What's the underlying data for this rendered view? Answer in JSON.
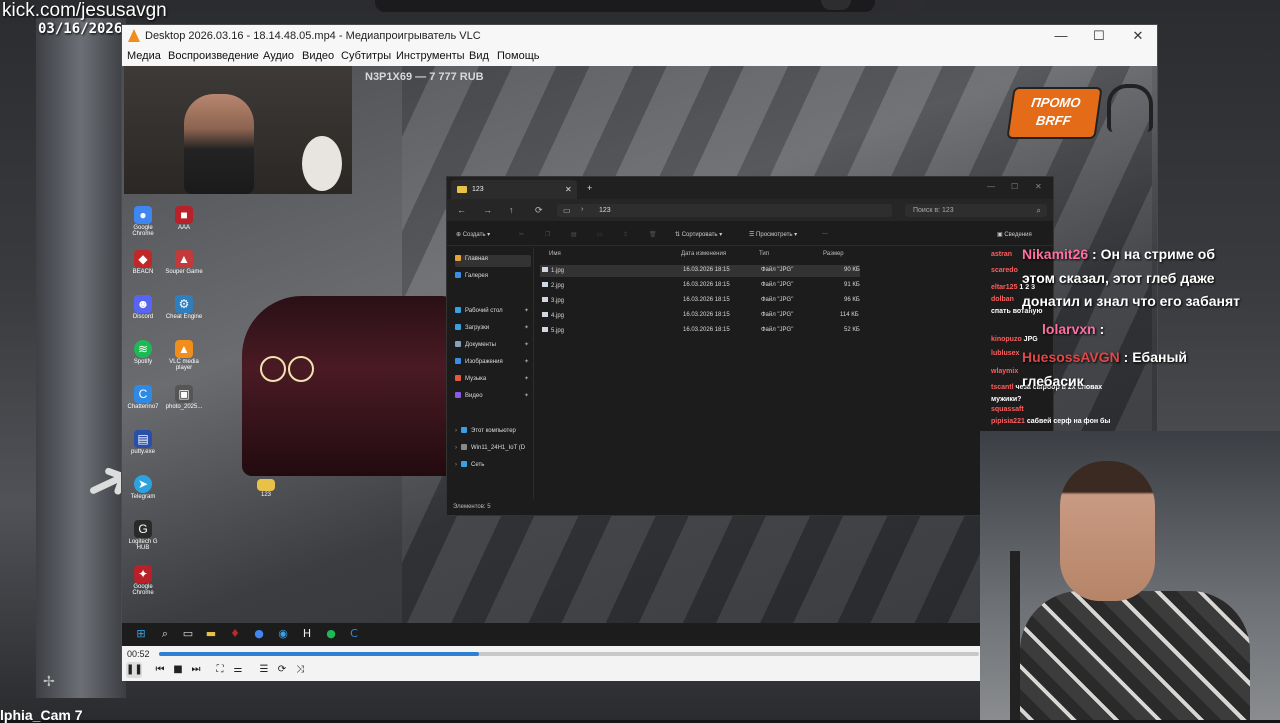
{
  "stream": {
    "url": "kick.com/jesusavgn",
    "date": "03/16/2026",
    "cam_label": "lphia_Cam 7",
    "overlay_price": "N3P1X69 — 7 777 RUB",
    "promo_line1": "ПРОМО",
    "promo_line2": "BRFF"
  },
  "vlc": {
    "title": "Desktop 2026.03.16 - 18.14.48.05.mp4 - Медиапроигрыватель VLC",
    "menu": [
      "Медиа",
      "Воспроизведение",
      "Аудио",
      "Видео",
      "Субтитры",
      "Инструменты",
      "Вид",
      "Помощь"
    ],
    "elapsed": "00:52",
    "progress_fraction": 0.39,
    "accent": "#2f7fd3"
  },
  "desktop_icons": [
    {
      "label": "Google Chrome",
      "icon": "chrome-icon",
      "color": "#3f86f0"
    },
    {
      "label": "ААА",
      "icon": "app-icon",
      "color": "#b8202a"
    },
    {
      "label": "BEACN",
      "icon": "beacn-icon",
      "color": "#c02828"
    },
    {
      "label": "Souper Game",
      "icon": "game-icon",
      "color": "#c43a3a"
    },
    {
      "label": "Discord",
      "icon": "discord-icon",
      "color": "#5865f2"
    },
    {
      "label": "Cheat Engine",
      "icon": "cheat-engine-icon",
      "color": "#2d7fbf"
    },
    {
      "label": "Spotify",
      "icon": "spotify-icon",
      "color": "#1db954"
    },
    {
      "label": "VLC media player",
      "icon": "vlc-icon",
      "color": "#f08d1b"
    },
    {
      "label": "Chatterino7",
      "icon": "chatterino-icon",
      "color": "#2f8ae6"
    },
    {
      "label": "photo_2025...",
      "icon": "photo-icon",
      "color": "#555555"
    },
    {
      "label": "putty.exe",
      "icon": "putty-icon",
      "color": "#2a4fa8"
    },
    {
      "label": "Telegram",
      "icon": "telegram-icon",
      "color": "#2aa3e0"
    },
    {
      "label": "123",
      "icon": "folder-icon",
      "color": "#e8c14a"
    },
    {
      "label": "Logitech G HUB",
      "icon": "logitech-icon",
      "color": "#2a2a2a"
    },
    {
      "label": "Google Chrome",
      "icon": "app-icon",
      "color": "#b8202a"
    }
  ],
  "explorer": {
    "tab_title": "123",
    "path": "123",
    "search_placeholder": "Поиск в: 123",
    "toolbar": {
      "create": "Создать",
      "sort": "Сортировать",
      "view": "Просмотреть",
      "more": "···",
      "details": "Сведения"
    },
    "sidebar": [
      {
        "label": "Главная",
        "icon": "home-icon",
        "color": "#e5a23a"
      },
      {
        "label": "Галерея",
        "icon": "gallery-icon",
        "color": "#3a8ee5"
      },
      {
        "label": "Рабочий стол",
        "icon": "desktop-icon",
        "color": "#3aa0e5"
      },
      {
        "label": "Загрузки",
        "icon": "downloads-icon",
        "color": "#3aa0e5"
      },
      {
        "label": "Документы",
        "icon": "documents-icon",
        "color": "#8aa0b8"
      },
      {
        "label": "Изображения",
        "icon": "pictures-icon",
        "color": "#3a8ee5"
      },
      {
        "label": "Музыка",
        "icon": "music-icon",
        "color": "#e55a3a"
      },
      {
        "label": "Видео",
        "icon": "videos-icon",
        "color": "#8a5ae5"
      },
      {
        "label": "Этот компьютер",
        "icon": "computer-icon",
        "color": "#3aa0e5"
      },
      {
        "label": "Win11_24H1_IoT (D",
        "icon": "drive-icon",
        "color": "#888888"
      },
      {
        "label": "Сеть",
        "icon": "network-icon",
        "color": "#3aa0e5"
      }
    ],
    "columns": [
      "Имя",
      "Дата изменения",
      "Тип",
      "Размер"
    ],
    "files": [
      {
        "name": "1.jpg",
        "date": "16.03.2026 18:15",
        "type": "Файл \"JPG\"",
        "size": "90 КБ"
      },
      {
        "name": "2.jpg",
        "date": "16.03.2026 18:15",
        "type": "Файл \"JPG\"",
        "size": "91 КБ"
      },
      {
        "name": "3.jpg",
        "date": "16.03.2026 18:15",
        "type": "Файл \"JPG\"",
        "size": "96 КБ"
      },
      {
        "name": "4.jpg",
        "date": "16.03.2026 18:15",
        "type": "Файл \"JPG\"",
        "size": "114 КБ"
      },
      {
        "name": "5.jpg",
        "date": "16.03.2026 18:15",
        "type": "Файл \"JPG\"",
        "size": "52 КБ"
      }
    ],
    "status": "Элементов: 5"
  },
  "chat": {
    "small_lines": [
      {
        "nick": "astran",
        "text": ""
      },
      {
        "nick": "scaredo",
        "text": ""
      },
      {
        "nick": "eltar125",
        "text": "1 2 3"
      },
      {
        "nick": "dolban",
        "text": ""
      },
      {
        "nick": "",
        "text": "спать вотаную"
      },
      {
        "nick": "kinopuzo",
        "text": "JPG"
      },
      {
        "nick": "lublusex",
        "text": ""
      },
      {
        "nick": "wlaymix",
        "text": ""
      },
      {
        "nick": "tscantl",
        "text": "чеза сырбор в 2х словах"
      },
      {
        "nick": "",
        "text": "мужики?"
      },
      {
        "nick": "squassaft",
        "text": ""
      },
      {
        "nick": "pipisia221",
        "text": "сабвей серф на фон бы"
      }
    ],
    "big_1_nick": "Nikamit26",
    "big_1_text": ": Он на стриме об",
    "big_1_line2": "этом сказал, этот глеб даже",
    "big_1_line3": "донатил и знал что его забанят",
    "big_2_nick": "lolarvxn",
    "big_2_text": ":",
    "big_3_nick": "HuesossAVGN",
    "big_3_text": ": Ебаный",
    "big_3_line2": "глебасик"
  }
}
